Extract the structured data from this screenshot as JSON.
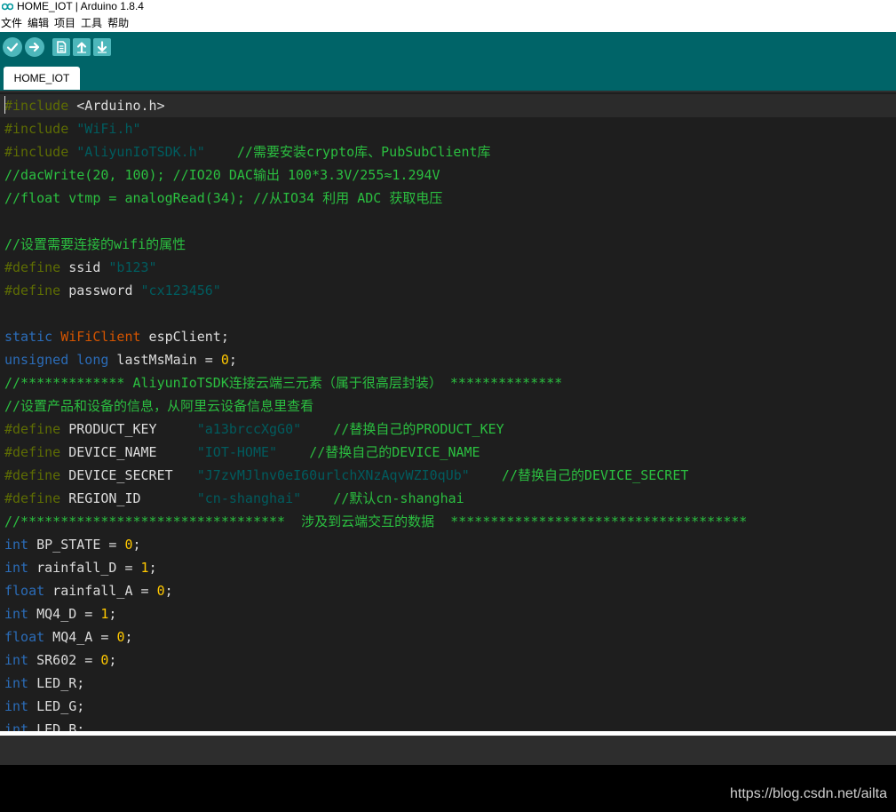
{
  "window": {
    "title": "HOME_IOT | Arduino 1.8.4",
    "logo_icon": "arduino-infinity-icon"
  },
  "menu": {
    "items": [
      "文件",
      "编辑",
      "项目",
      "工具",
      "帮助"
    ]
  },
  "toolbar": {
    "buttons": [
      {
        "name": "verify",
        "icon": "check-icon"
      },
      {
        "name": "upload",
        "icon": "arrow-right-icon"
      },
      {
        "name": "new",
        "icon": "new-file-icon"
      },
      {
        "name": "open",
        "icon": "arrow-up-icon"
      },
      {
        "name": "save",
        "icon": "arrow-down-icon"
      }
    ]
  },
  "tab": {
    "label": "HOME_IOT"
  },
  "colors": {
    "toolbar": "#006468",
    "button": "#4db7bb",
    "editor_bg": "#1e1e1e",
    "comment": "#2bbf40",
    "preprocessor": "#5e6d03",
    "string": "#005c5f",
    "keyword": "#2b6cb8",
    "class": "#d35400",
    "number": "#ffc800"
  },
  "code": {
    "lines": [
      [
        {
          "c": "pp",
          "t": "#include"
        },
        {
          "c": "txt",
          "t": " <Arduino.h>"
        }
      ],
      [
        {
          "c": "pp",
          "t": "#include"
        },
        {
          "c": "txt",
          "t": " "
        },
        {
          "c": "str",
          "t": "\"WiFi.h\""
        }
      ],
      [
        {
          "c": "pp",
          "t": "#include"
        },
        {
          "c": "txt",
          "t": " "
        },
        {
          "c": "str",
          "t": "\"AliyunIoTSDK.h\""
        },
        {
          "c": "txt",
          "t": "    "
        },
        {
          "c": "cmt",
          "t": "//需要安装crypto库、PubSubClient库"
        }
      ],
      [
        {
          "c": "cmt",
          "t": "//dacWrite(20, 100); //IO20 DAC输出 100*3.3V/255≈1.294V"
        }
      ],
      [
        {
          "c": "cmt",
          "t": "//float vtmp = analogRead(34); //从IO34 利用 ADC 获取电压"
        }
      ],
      [],
      [
        {
          "c": "cmt",
          "t": "//设置需要连接的wifi的属性"
        }
      ],
      [
        {
          "c": "pp",
          "t": "#define"
        },
        {
          "c": "txt",
          "t": " ssid "
        },
        {
          "c": "str",
          "t": "\"b123\""
        }
      ],
      [
        {
          "c": "pp",
          "t": "#define"
        },
        {
          "c": "txt",
          "t": " password "
        },
        {
          "c": "str",
          "t": "\"cx123456\""
        }
      ],
      [],
      [
        {
          "c": "kw",
          "t": "static"
        },
        {
          "c": "txt",
          "t": " "
        },
        {
          "c": "type",
          "t": "WiFiClient"
        },
        {
          "c": "txt",
          "t": " espClient;"
        }
      ],
      [
        {
          "c": "kw",
          "t": "unsigned"
        },
        {
          "c": "txt",
          "t": " "
        },
        {
          "c": "kw",
          "t": "long"
        },
        {
          "c": "txt",
          "t": " lastMsMain = "
        },
        {
          "c": "num",
          "t": "0"
        },
        {
          "c": "txt",
          "t": ";"
        }
      ],
      [
        {
          "c": "cmt",
          "t": "//************* AliyunIoTSDK连接云端三元素（属于很高层封装） **************"
        }
      ],
      [
        {
          "c": "cmt",
          "t": "//设置产品和设备的信息，从阿里云设备信息里查看"
        }
      ],
      [
        {
          "c": "pp",
          "t": "#define"
        },
        {
          "c": "txt",
          "t": " PRODUCT_KEY     "
        },
        {
          "c": "str",
          "t": "\"a13brccXgG0\""
        },
        {
          "c": "txt",
          "t": "    "
        },
        {
          "c": "cmt",
          "t": "//替换自己的PRODUCT_KEY"
        }
      ],
      [
        {
          "c": "pp",
          "t": "#define"
        },
        {
          "c": "txt",
          "t": " DEVICE_NAME     "
        },
        {
          "c": "str",
          "t": "\"IOT-HOME\""
        },
        {
          "c": "txt",
          "t": "    "
        },
        {
          "c": "cmt",
          "t": "//替换自己的DEVICE_NAME"
        }
      ],
      [
        {
          "c": "pp",
          "t": "#define"
        },
        {
          "c": "txt",
          "t": " DEVICE_SECRET   "
        },
        {
          "c": "str",
          "t": "\"J7zvMJlnv0eI60urlchXNzAqvWZI0qUb\""
        },
        {
          "c": "txt",
          "t": "    "
        },
        {
          "c": "cmt",
          "t": "//替换自己的DEVICE_SECRET"
        }
      ],
      [
        {
          "c": "pp",
          "t": "#define"
        },
        {
          "c": "txt",
          "t": " REGION_ID       "
        },
        {
          "c": "str",
          "t": "\"cn-shanghai\""
        },
        {
          "c": "txt",
          "t": "    "
        },
        {
          "c": "cmt",
          "t": "//默认cn-shanghai"
        }
      ],
      [
        {
          "c": "cmt",
          "t": "//*********************************  涉及到云端交互的数据  *************************************"
        }
      ],
      [
        {
          "c": "kw",
          "t": "int"
        },
        {
          "c": "txt",
          "t": " BP_STATE = "
        },
        {
          "c": "num",
          "t": "0"
        },
        {
          "c": "txt",
          "t": ";"
        }
      ],
      [
        {
          "c": "kw",
          "t": "int"
        },
        {
          "c": "txt",
          "t": " rainfall_D = "
        },
        {
          "c": "num",
          "t": "1"
        },
        {
          "c": "txt",
          "t": ";"
        }
      ],
      [
        {
          "c": "kw",
          "t": "float"
        },
        {
          "c": "txt",
          "t": " rainfall_A = "
        },
        {
          "c": "num",
          "t": "0"
        },
        {
          "c": "txt",
          "t": ";"
        }
      ],
      [
        {
          "c": "kw",
          "t": "int"
        },
        {
          "c": "txt",
          "t": " MQ4_D = "
        },
        {
          "c": "num",
          "t": "1"
        },
        {
          "c": "txt",
          "t": ";"
        }
      ],
      [
        {
          "c": "kw",
          "t": "float"
        },
        {
          "c": "txt",
          "t": " MQ4_A = "
        },
        {
          "c": "num",
          "t": "0"
        },
        {
          "c": "txt",
          "t": ";"
        }
      ],
      [
        {
          "c": "kw",
          "t": "int"
        },
        {
          "c": "txt",
          "t": " SR602 = "
        },
        {
          "c": "num",
          "t": "0"
        },
        {
          "c": "txt",
          "t": ";"
        }
      ],
      [
        {
          "c": "kw",
          "t": "int"
        },
        {
          "c": "txt",
          "t": " LED_R;"
        }
      ],
      [
        {
          "c": "kw",
          "t": "int"
        },
        {
          "c": "txt",
          "t": " LED_G;"
        }
      ],
      [
        {
          "c": "kw",
          "t": "int"
        },
        {
          "c": "txt",
          "t": " LED_B;"
        }
      ]
    ]
  },
  "watermark": "https://blog.csdn.net/ailta"
}
